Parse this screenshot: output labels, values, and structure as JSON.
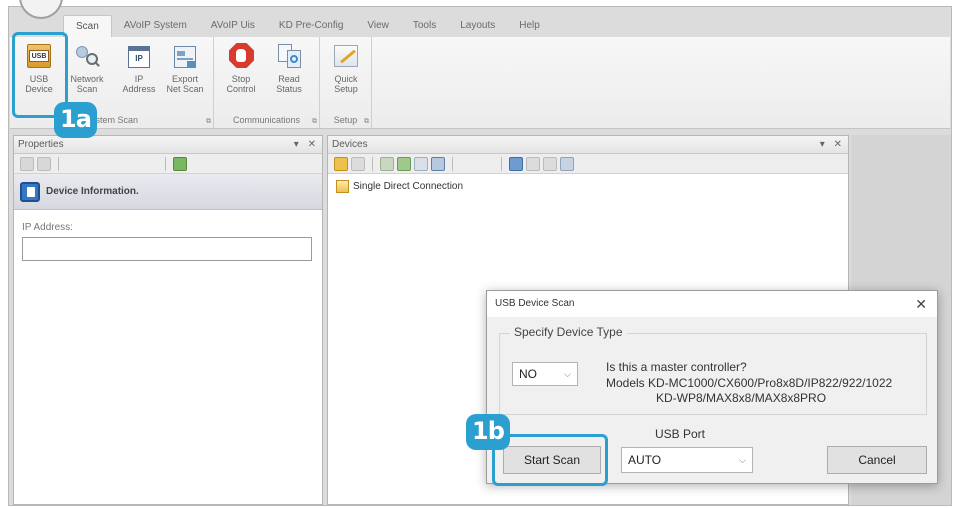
{
  "menu": {
    "tabs": [
      "Scan",
      "AVoIP System",
      "AVoIP Uis",
      "KD Pre-Config",
      "View",
      "Tools",
      "Layouts",
      "Help"
    ],
    "active_tab": "Scan"
  },
  "ribbon": {
    "usb_device": {
      "line1": "USB",
      "line2": "Device",
      "icon_text": "USB"
    },
    "network_scan": {
      "line1": "Network",
      "line2": "Scan"
    },
    "ip_address": {
      "line1": "IP",
      "line2": "Address",
      "icon_text": "IP"
    },
    "export_net_scan": {
      "line1": "Export",
      "line2": "Net Scan"
    },
    "stop_control": {
      "line1": "Stop",
      "line2": "Control"
    },
    "read_status": {
      "line1": "Read",
      "line2": "Status"
    },
    "quick_setup": {
      "line1": "Quick",
      "line2": "Setup"
    },
    "groups": {
      "system_scan": "System Scan",
      "communications": "Communications",
      "setup": "Setup"
    }
  },
  "callouts": {
    "a": "1a",
    "b": "1b"
  },
  "properties": {
    "title": "Properties",
    "pin": "▾",
    "close": "✕",
    "section_title": "Device Information.",
    "ip_label": "IP Address:",
    "ip_value": ""
  },
  "devices": {
    "title": "Devices",
    "pin": "▾",
    "close": "✕",
    "tree_item": "Single Direct Connection"
  },
  "dialog": {
    "title": "USB Device Scan",
    "close": "✕",
    "group_title": "Specify Device Type",
    "device_type_value": "NO",
    "question": "Is this a master controller?",
    "models_line1": "Models KD-MC1000/CX600/Pro8x8D/IP822/922/1022",
    "models_line2": "KD-WP8/MAX8x8/MAX8x8PRO",
    "usb_port_label": "USB Port",
    "usb_port_value": "AUTO",
    "start_button": "Start Scan",
    "cancel_button": "Cancel"
  },
  "colors": {
    "callout": "#2a9fd0",
    "stop_icon": "#d83a2e",
    "usb_icon": "#d79a2b"
  }
}
